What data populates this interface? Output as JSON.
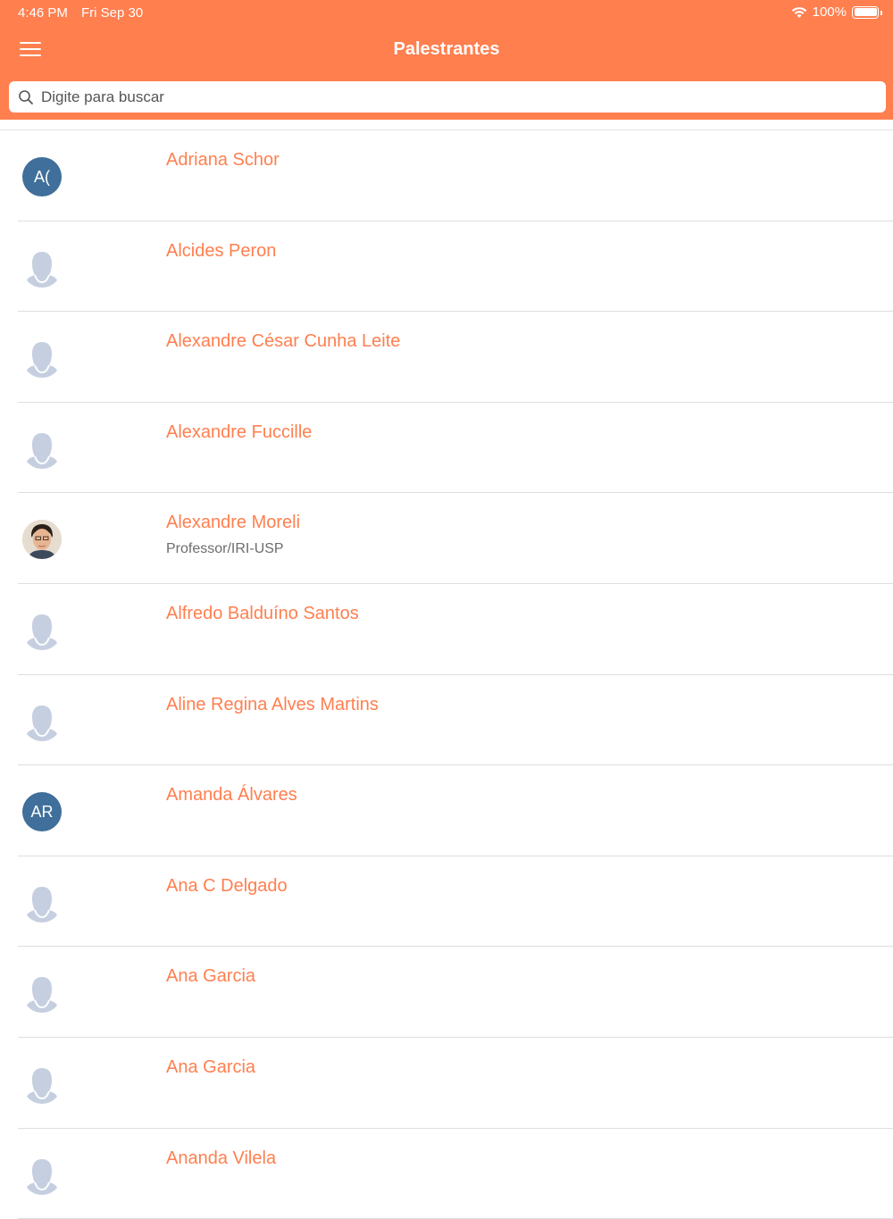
{
  "status_bar": {
    "time": "4:46 PM",
    "date": "Fri Sep 30",
    "battery": "100%"
  },
  "header": {
    "title": "Palestrantes",
    "menu_icon": "hamburger-menu-icon",
    "background_color": "#ff7f4f"
  },
  "search": {
    "placeholder": "Digite para buscar",
    "value": "",
    "icon": "search-icon"
  },
  "speakers": [
    {
      "name": "Adriana Schor",
      "subtitle": "",
      "avatar_type": "initials",
      "initials": "A("
    },
    {
      "name": "Alcides Peron",
      "subtitle": "",
      "avatar_type": "placeholder",
      "initials": ""
    },
    {
      "name": "Alexandre César Cunha Leite",
      "subtitle": "",
      "avatar_type": "placeholder",
      "initials": ""
    },
    {
      "name": "Alexandre Fuccille",
      "subtitle": "",
      "avatar_type": "placeholder",
      "initials": ""
    },
    {
      "name": "Alexandre Moreli",
      "subtitle": "Professor/IRI-USP",
      "avatar_type": "photo",
      "initials": ""
    },
    {
      "name": "Alfredo Balduíno Santos",
      "subtitle": "",
      "avatar_type": "placeholder",
      "initials": ""
    },
    {
      "name": "Aline Regina Alves Martins",
      "subtitle": "",
      "avatar_type": "placeholder",
      "initials": ""
    },
    {
      "name": "Amanda Álvares",
      "subtitle": "",
      "avatar_type": "initials",
      "initials": "AR"
    },
    {
      "name": "Ana C Delgado",
      "subtitle": "",
      "avatar_type": "placeholder",
      "initials": ""
    },
    {
      "name": "Ana Garcia",
      "subtitle": "",
      "avatar_type": "placeholder",
      "initials": ""
    },
    {
      "name": "Ana Garcia",
      "subtitle": "",
      "avatar_type": "placeholder",
      "initials": ""
    },
    {
      "name": "Ananda Vilela",
      "subtitle": "",
      "avatar_type": "placeholder",
      "initials": ""
    }
  ],
  "colors": {
    "accent": "#ff7f4f",
    "initials_avatar": "#3f6f9a",
    "placeholder_avatar": "#c5cfe0"
  }
}
